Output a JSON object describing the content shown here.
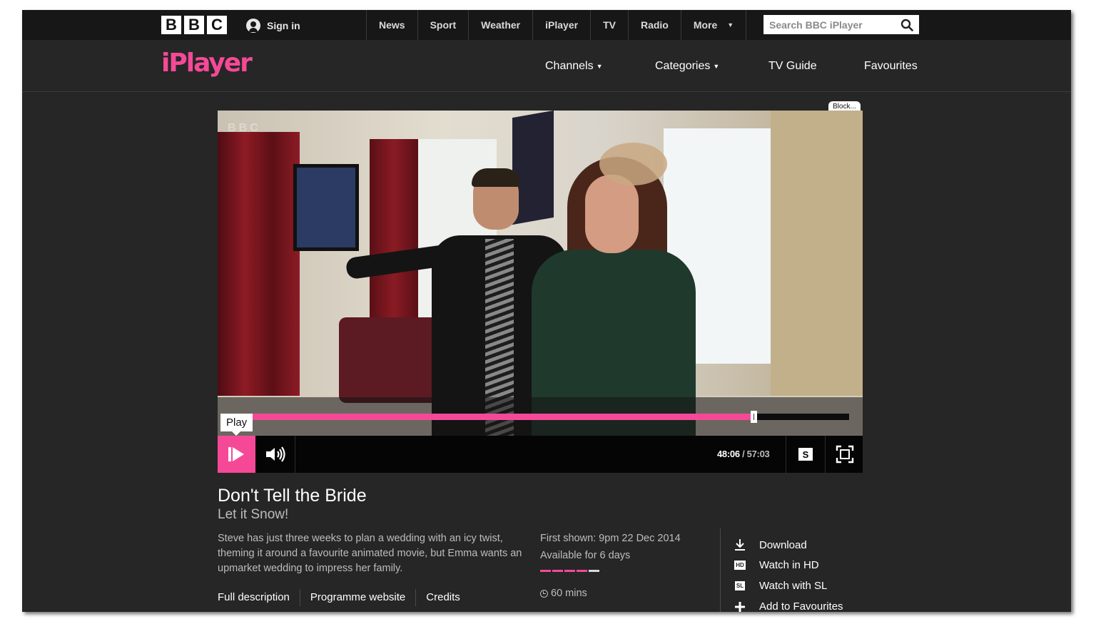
{
  "global": {
    "logo_letters": [
      "B",
      "B",
      "C"
    ],
    "signin_label": "Sign in",
    "nav": [
      "News",
      "Sport",
      "Weather",
      "iPlayer",
      "TV",
      "Radio",
      "More"
    ],
    "search_placeholder": "Search BBC iPlayer"
  },
  "iplayer": {
    "logo_text": "iPlayer",
    "nav": {
      "channels": "Channels",
      "categories": "Categories",
      "tv_guide": "TV Guide",
      "favourites": "Favourites"
    }
  },
  "player": {
    "block_label": "Block...",
    "video_watermark": "BBC",
    "tooltip": "Play",
    "progress_fraction": 0.843,
    "current_time": "48:06",
    "total_time": "/ 57:03",
    "subtitles_label": "S"
  },
  "programme": {
    "title": "Don't Tell the Bride",
    "episode": "Let it Snow!",
    "description": "Steve has just three weeks to plan a wedding with an icy twist, theming it around a favourite animated movie, but Emma wants an upmarket wedding to impress her family.",
    "links": [
      "Full description",
      "Programme website",
      "Credits"
    ],
    "first_shown": "First shown: 9pm 22 Dec 2014",
    "available": "Available for 6 days",
    "duration": "60 mins",
    "actions": {
      "download": "Download",
      "watch_hd": "Watch in HD",
      "hd_badge": "HD",
      "watch_sl": "Watch with SL",
      "sl_badge": "SL",
      "favourites": "Add to Favourites"
    }
  },
  "colors": {
    "accent": "#f54997",
    "background": "#262626",
    "global_bar": "#171717"
  },
  "availability_segments": [
    "#f54997",
    "#f54997",
    "#f54997",
    "#f54997",
    "#d9d9d9"
  ]
}
